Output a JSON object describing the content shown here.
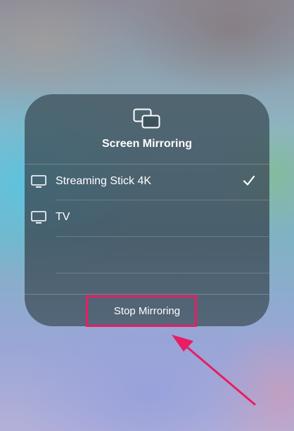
{
  "panel": {
    "title": "Screen Mirroring",
    "header_icon": "screen-mirroring-icon"
  },
  "devices": [
    {
      "label": "Streaming Stick 4K",
      "icon": "tv-icon",
      "selected": true
    },
    {
      "label": "TV",
      "icon": "tv-icon",
      "selected": false
    }
  ],
  "footer": {
    "stop_label": "Stop Mirroring"
  },
  "annotation": {
    "highlight_color": "#e81d63",
    "arrow_color": "#e81d63"
  }
}
